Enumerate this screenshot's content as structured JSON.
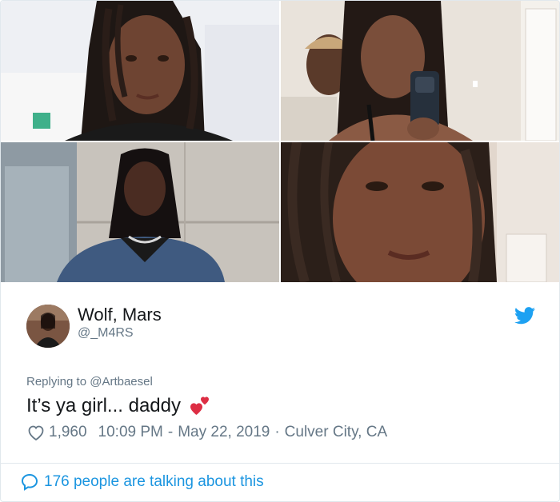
{
  "photos": [
    {
      "name": "photo-1"
    },
    {
      "name": "photo-2"
    },
    {
      "name": "photo-3"
    },
    {
      "name": "photo-4"
    }
  ],
  "tweet": {
    "display_name": "Wolf, Mars",
    "handle": "@_M4RS",
    "replying_prefix": "Replying to ",
    "replying_to": "@Artbaesel",
    "text": "It’s ya girl... daddy",
    "emoji_icon": "two-hearts-icon",
    "likes": "1,960",
    "time": "10:09 PM",
    "date": "May 22, 2019",
    "dash": "-",
    "dot": "·",
    "location": "Culver City, CA",
    "talking": "176 people are talking about this"
  },
  "colors": {
    "twitter_blue": "#1da1f2",
    "link_blue": "#1b95e0",
    "muted": "#657786",
    "text": "#14171a",
    "heart_red": "#e0245e"
  }
}
